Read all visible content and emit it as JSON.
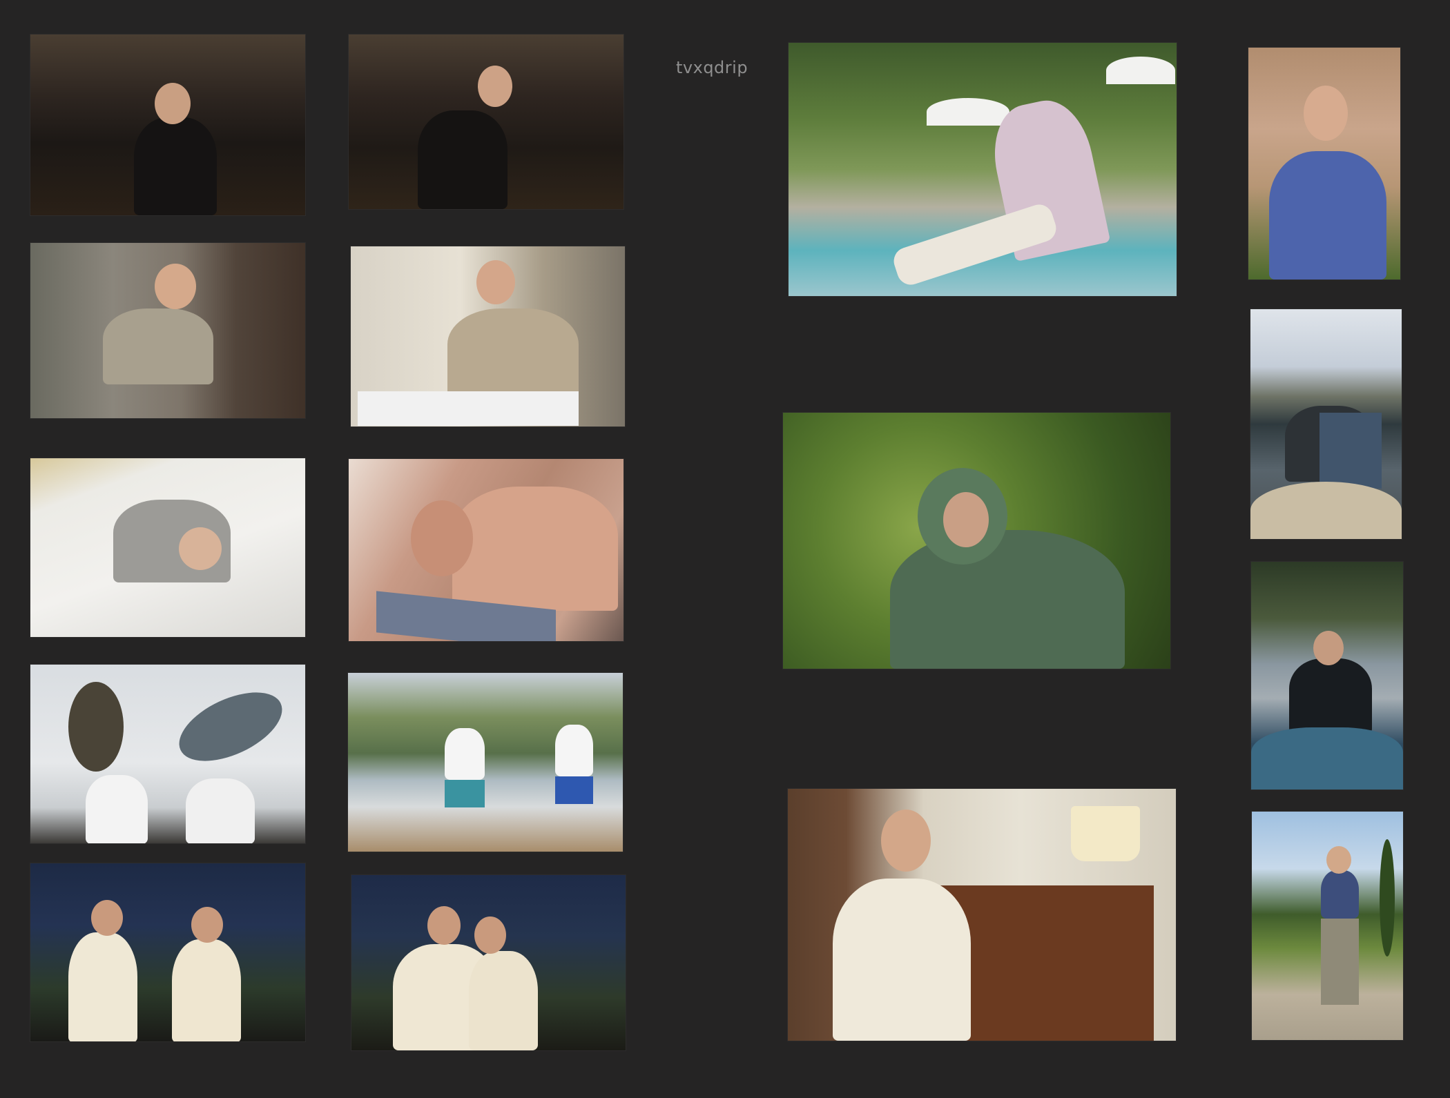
{
  "watermark": "tvxqdrip",
  "photos": [
    {
      "id": "p1",
      "alt": "",
      "tag": ""
    },
    {
      "id": "p2",
      "alt": "",
      "tag": ""
    },
    {
      "id": "p3",
      "alt": "",
      "tag": ""
    },
    {
      "id": "p4",
      "alt": "",
      "tag": ""
    },
    {
      "id": "p5",
      "alt": "",
      "tag": ""
    },
    {
      "id": "p6",
      "alt": "",
      "tag": ""
    },
    {
      "id": "p7",
      "alt": "",
      "tag": ""
    },
    {
      "id": "p8",
      "alt": "",
      "tag": ""
    },
    {
      "id": "p9",
      "alt": "",
      "tag": ""
    },
    {
      "id": "p10",
      "alt": "",
      "tag": ""
    },
    {
      "id": "p11",
      "alt": "",
      "tag": ""
    },
    {
      "id": "p12",
      "alt": "",
      "tag": ""
    },
    {
      "id": "p13",
      "alt": "",
      "tag": ""
    },
    {
      "id": "p14",
      "alt": "",
      "tag": ""
    },
    {
      "id": "p15",
      "alt": "",
      "tag": ""
    },
    {
      "id": "p16",
      "alt": "",
      "tag": ""
    },
    {
      "id": "p17",
      "alt": "",
      "tag": ""
    }
  ]
}
